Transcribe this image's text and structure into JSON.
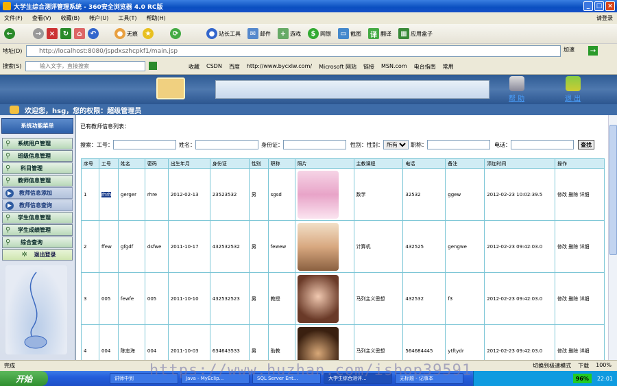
{
  "window": {
    "title": "大学生综合测评管理系统 - 360安全浏览器 4.0 RC版"
  },
  "menu": {
    "items": [
      "文件(F)",
      "查看(V)",
      "收藏(B)",
      "帐户(U)",
      "工具(T)",
      "帮助(H)"
    ],
    "login": "请登录"
  },
  "toolbar": {
    "none_label": "无痕",
    "items": [
      "站长工具",
      "邮件",
      "游戏",
      "网银",
      "截图",
      "翻译",
      "应用盒子"
    ]
  },
  "address": {
    "label": "地址(D)",
    "url": "http://localhost:8080/jspdxszhcpkf1/main.jsp",
    "speed": "加速"
  },
  "favbar": {
    "label": "搜索(S)",
    "placeholder": "输入文字，直接搜索",
    "links": [
      "收藏",
      "CSDN",
      "百度",
      "http://www.bycxlw.com/",
      "Microsoft 网站",
      "链接",
      "MSN.com",
      "电台指南",
      "常用"
    ]
  },
  "header": {
    "help": "帮 助",
    "exit": "退 出"
  },
  "welcome": "欢迎您，hsg，您的权限：超级管理员",
  "sidebar": {
    "title": "系统功能菜单",
    "items": [
      "系统用户管理",
      "班级信息管理",
      "科目管理",
      "教师信息管理"
    ],
    "subitems": [
      "教师信息添加",
      "教师信息查询"
    ],
    "items2": [
      "学生信息管理",
      "学生成绩管理",
      "综合查询"
    ],
    "logout": "退出登录"
  },
  "main": {
    "list_title": "已有教师信息列表：",
    "search": {
      "label": "搜索：",
      "f1": "工号：",
      "f2": "姓名：",
      "f3": "身份证：",
      "f4": "性别：",
      "f4b": "性别：",
      "gender_value": "所有",
      "f5": "职称：",
      "f6": "电话：",
      "button": "查找"
    },
    "headers": [
      "序号",
      "工号",
      "姓名",
      "密码",
      "出生年月",
      "身份证",
      "性别",
      "职称",
      "照片",
      "主教课程",
      "电话",
      "备注",
      "添加时间",
      "操作"
    ],
    "rows": [
      [
        "1",
        "rhrh",
        "gerger",
        "rhre",
        "2012-02-13",
        "23523532",
        "男",
        "sgsd",
        "",
        "数学",
        "32532",
        "ggew",
        "2012-02-23 10:02:39.5",
        "修改 删除 详细"
      ],
      [
        "2",
        "ffew",
        "gfgdf",
        "dsfwe",
        "2011-10-17",
        "432532532",
        "男",
        "fewew",
        "",
        "计算机",
        "432525",
        "gengwe",
        "2012-02-23 09:42:03.0",
        "修改 删除 详细"
      ],
      [
        "3",
        "005",
        "fewfe",
        "005",
        "2011-10-10",
        "432532523",
        "男",
        "教授",
        "",
        "马列主义思想",
        "432532",
        "f3",
        "2012-02-23 09:42:03.0",
        "修改 删除 详细"
      ],
      [
        "4",
        "004",
        "陈志海",
        "004",
        "2011-10-03",
        "634643533",
        "男",
        "助教",
        "",
        "马列主义思想",
        "564684445",
        "ytftydr",
        "2012-02-23 09:42:03.0",
        "修改 删除 详细"
      ]
    ]
  },
  "status": {
    "left": "完成",
    "right": [
      "切换到极速模式",
      "下载",
      "100%"
    ]
  },
  "taskbar": {
    "start": "开始",
    "tasks": [
      "讲师中到",
      "Java - MyEclip...",
      "SQL Server Ent...",
      "大学生综合测评...",
      "无标题 - 记事本"
    ],
    "battery": "96%",
    "time": "22:01"
  },
  "watermark": "https://www.huzhan.com/ishop39591"
}
